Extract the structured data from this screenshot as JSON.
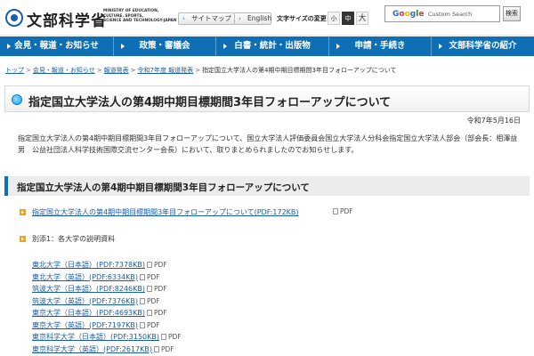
{
  "header": {
    "logo_text": "文部科学省",
    "logo_sub": [
      "MINISTRY OF EDUCATION,",
      "CULTURE, SPORTS,",
      "SCIENCE AND TECHNOLOGY-JAPAN"
    ],
    "sitemap_label": "サイトマップ",
    "english_label": "English",
    "font_size_label": "文字サイズの変更",
    "font_sizes": [
      "小",
      "中",
      "大"
    ],
    "search_brand": [
      "G",
      "o",
      "o",
      "g",
      "l",
      "e"
    ],
    "search_placeholder": "Custom Search",
    "search_button": "検索"
  },
  "nav": {
    "items": [
      "会見・報道・お知らせ",
      "政策・審議会",
      "白書・統計・出版物",
      "申請・手続き",
      "文部科学省の紹介"
    ]
  },
  "breadcrumb": {
    "items": [
      "トップ",
      "会見・報道・お知らせ",
      "報道発表",
      "令和7年度 報道発表"
    ],
    "current": "指定国立大学法人の第4期中期目標期間3年目フォローアップについて"
  },
  "page": {
    "title": "指定国立大学法人の第4期中期目標期間3年目フォローアップについて",
    "date": "令和7年5月16日",
    "intro": "指定国立大学法人の第4期中期目標期間3年目フォローアップについて、国立大学法人評価委員会国立大学法人分科会指定国立大学法人部会（部会長：相澤益男　公益社団法人科学技術国際交流センター会長）において、取りまとめられましたのでお知らせします。",
    "section_heading": "指定国立大学法人の第4期中期目標期間3年目フォローアップについて",
    "main_link": "指定国立大学法人の第4期中期目標期間3年目フォローアップについて(PDF:172KB)",
    "annex_label": "別添1：各大学の説明資料",
    "pdf_alt": "PDF",
    "universities": [
      "東北大学（日本語）(PDF:7378KB)",
      "東北大学（英語）(PDF:6334KB)",
      "筑波大学（日本語）(PDF:8246KB)",
      "筑波大学（英語）(PDF:7376KB)",
      "東京大学（日本語）(PDF:4693KB)",
      "東京大学（英語）(PDF:7197KB)",
      "東京科学大学（日本語）(PDF:3150KB)",
      "東京科学大学（英語）(PDF:2617KB)"
    ]
  },
  "colors": {
    "nav_bg": "#0f6fb4",
    "link": "#1a5da8",
    "bullet": "#f0a020"
  }
}
